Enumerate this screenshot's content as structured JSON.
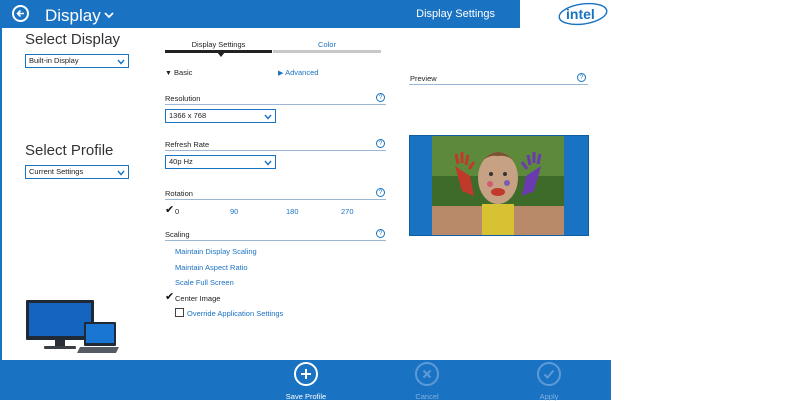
{
  "header": {
    "title": "Display",
    "page_heading": "Display Settings",
    "brand": "intel"
  },
  "left": {
    "select_display_title": "Select Display",
    "display_value": "Built-in Display",
    "select_profile_title": "Select Profile",
    "profile_value": "Current Settings"
  },
  "tabs": [
    {
      "label": "Display Settings",
      "active": true
    },
    {
      "label": "Color",
      "active": false
    }
  ],
  "mode": {
    "basic": "Basic",
    "advanced": "Advanced"
  },
  "resolution": {
    "label": "Resolution",
    "value": "1366 x 768"
  },
  "refresh": {
    "label": "Refresh Rate",
    "value": "40p Hz"
  },
  "rotation": {
    "label": "Rotation",
    "options": [
      "0",
      "90",
      "180",
      "270"
    ],
    "selected": "0"
  },
  "scaling": {
    "label": "Scaling",
    "options": [
      "Maintain Display Scaling",
      "Maintain Aspect Ratio",
      "Scale Full Screen",
      "Center Image"
    ],
    "selected": "Center Image",
    "override_label": "Override Application Settings",
    "override_checked": false
  },
  "preview": {
    "label": "Preview"
  },
  "footer": {
    "save": "Save Profile",
    "cancel": "Cancel",
    "apply": "Apply"
  },
  "colors": {
    "accent": "#1a73c2",
    "header_bg": "#1a73c2"
  },
  "icons": [
    "back-arrow-icon",
    "chevron-down-icon",
    "help-icon",
    "checkmark-icon",
    "plus-icon",
    "close-icon",
    "monitor-icon",
    "laptop-icon",
    "intel-logo"
  ]
}
